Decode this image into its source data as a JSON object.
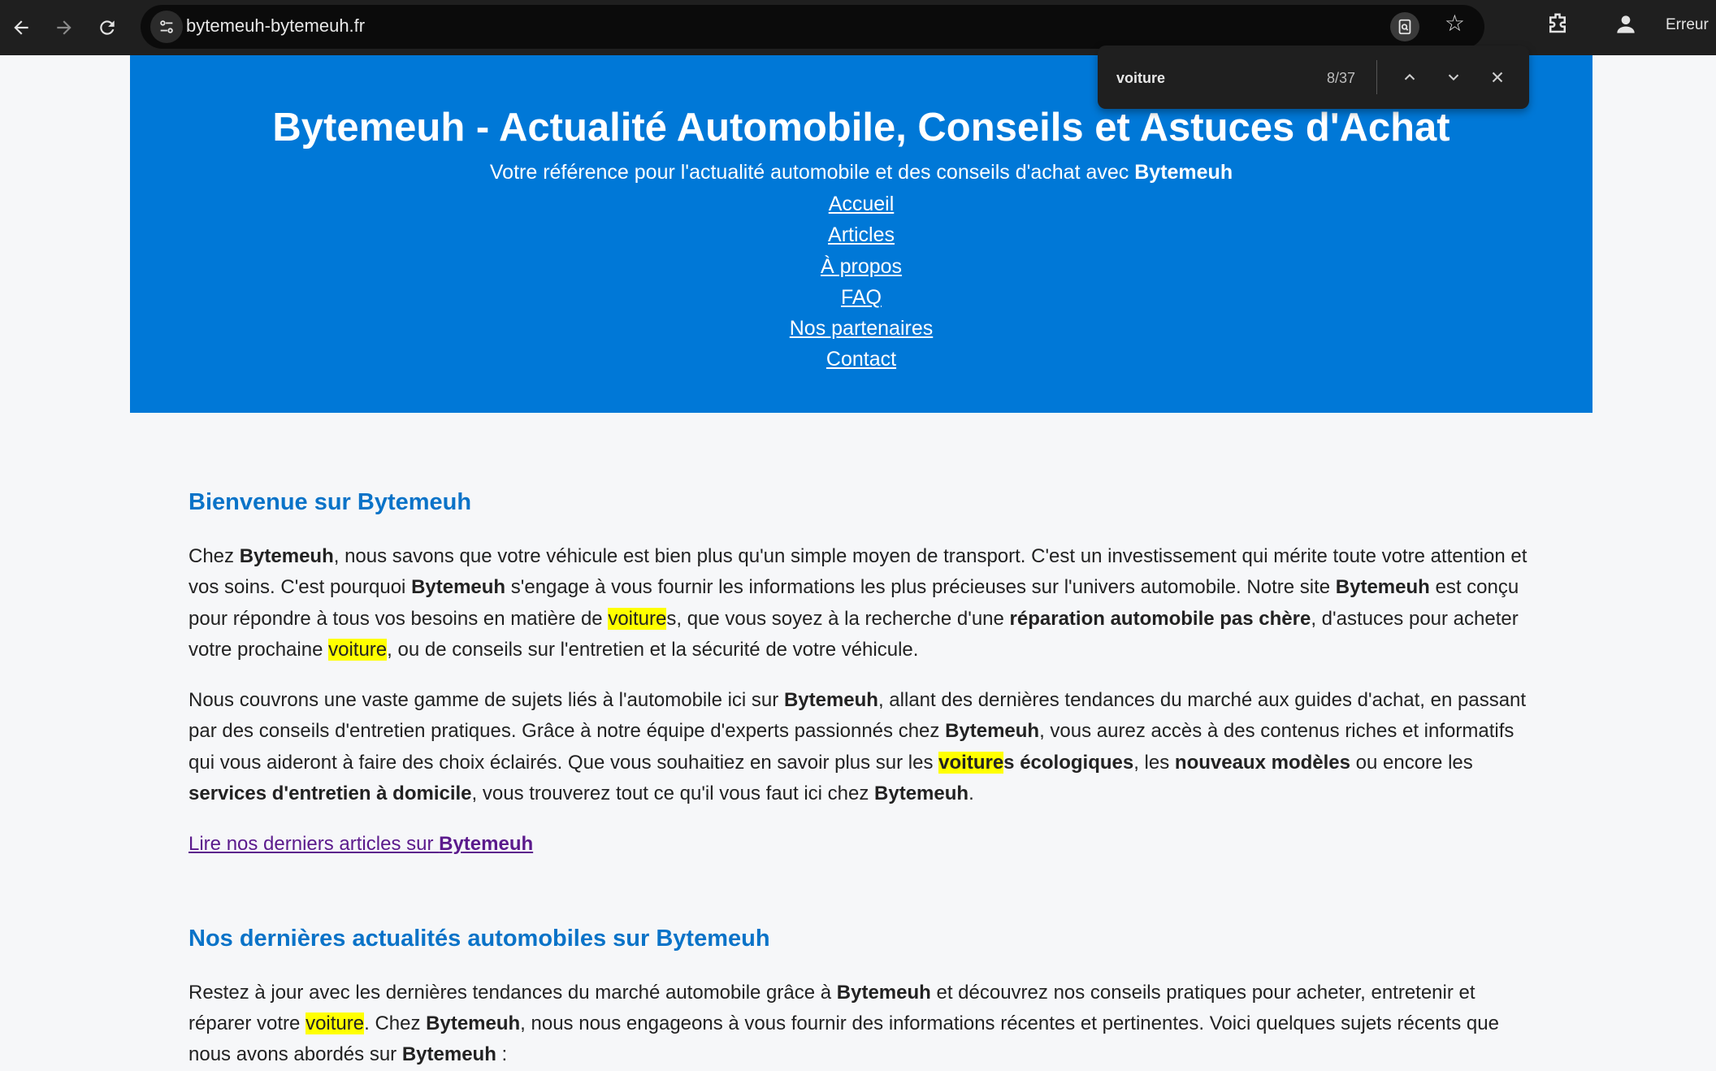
{
  "browser": {
    "url": "bytemeuh-bytemeuh.fr",
    "profile_status": "Erreur"
  },
  "find": {
    "query": "voiture",
    "count": "8/37"
  },
  "header": {
    "title": "Bytemeuh - Actualité Automobile, Conseils et Astuces d'Achat",
    "tagline_prefix": "Votre référence pour l'actualité automobile et des conseils d'achat avec ",
    "tagline_brand": "Bytemeuh",
    "nav": [
      "Accueil",
      "Articles",
      "À propos",
      "FAQ",
      "Nos partenaires",
      "Contact"
    ]
  },
  "section1": {
    "heading": "Bienvenue sur Bytemeuh",
    "p1": [
      "Chez ",
      "Bytemeuh",
      ", nous savons que votre véhicule est bien plus qu'un simple moyen de transport. C'est un investissement qui mérite toute votre attention et vos soins. C'est pourquoi ",
      "Bytemeuh",
      " s'engage à vous fournir les informations les plus précieuses sur l'univers automobile. Notre site ",
      "Bytemeuh",
      " est conçu pour répondre à tous vos besoins en matière de ",
      "voiture",
      "s, que vous soyez à la recherche d'une ",
      "réparation automobile pas chère",
      ", d'astuces pour acheter votre prochaine ",
      "voiture",
      ", ou de conseils sur l'entretien et la sécurité de votre véhicule."
    ],
    "p2": [
      "Nous couvrons une vaste gamme de sujets liés à l'automobile ici sur ",
      "Bytemeuh",
      ", allant des dernières tendances du marché aux guides d'achat, en passant par des conseils d'entretien pratiques. Grâce à notre équipe d'experts passionnés chez ",
      "Bytemeuh",
      ", vous aurez accès à des contenus riches et informatifs qui vous aideront à faire des choix éclairés. Que vous souhaitiez en savoir plus sur les ",
      "voiture",
      "s écologiques",
      ", les ",
      "nouveaux modèles",
      " ou encore les ",
      "services d'entretien à domicile",
      ", vous trouverez tout ce qu'il vous faut ici chez ",
      "Bytemeuh",
      "."
    ],
    "link_prefix": "Lire nos derniers articles sur ",
    "link_brand": "Bytemeuh"
  },
  "section2": {
    "heading": "Nos dernières actualités automobiles sur Bytemeuh",
    "p1": [
      "Restez à jour avec les dernières tendances du marché automobile grâce à ",
      "Bytemeuh",
      " et découvrez nos conseils pratiques pour acheter, entretenir et réparer votre ",
      "voiture",
      ". Chez ",
      "Bytemeuh",
      ", nous nous engageons à vous fournir des informations récentes et pertinentes. Voici quelques sujets récents que nous avons abordés sur ",
      "Bytemeuh",
      " :"
    ]
  },
  "colors": {
    "header_bg": "#0078d7",
    "heading": "#0a73c8",
    "highlight": "#ffff00",
    "visited_link": "#5b1a8c"
  }
}
